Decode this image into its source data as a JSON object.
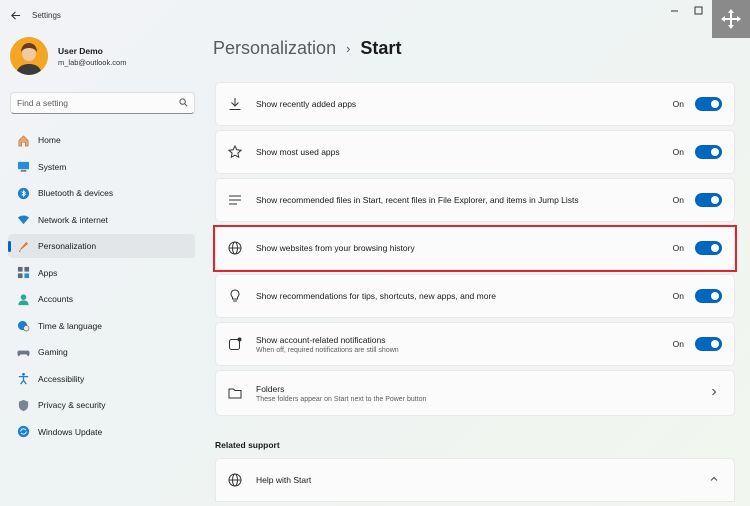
{
  "app": {
    "title": "Settings"
  },
  "user": {
    "name": "User Demo",
    "email": "m_lab@outlook.com"
  },
  "search": {
    "placeholder": "Find a setting"
  },
  "nav": [
    {
      "label": "Home",
      "icon": "home-icon"
    },
    {
      "label": "System",
      "icon": "system-icon"
    },
    {
      "label": "Bluetooth & devices",
      "icon": "bluetooth-icon"
    },
    {
      "label": "Network & internet",
      "icon": "wifi-icon"
    },
    {
      "label": "Personalization",
      "icon": "brush-icon",
      "active": true
    },
    {
      "label": "Apps",
      "icon": "apps-icon"
    },
    {
      "label": "Accounts",
      "icon": "accounts-icon"
    },
    {
      "label": "Time & language",
      "icon": "globe-clock-icon"
    },
    {
      "label": "Gaming",
      "icon": "controller-icon"
    },
    {
      "label": "Accessibility",
      "icon": "accessibility-icon"
    },
    {
      "label": "Privacy & security",
      "icon": "shield-icon"
    },
    {
      "label": "Windows Update",
      "icon": "update-icon"
    }
  ],
  "breadcrumb": {
    "parent": "Personalization",
    "separator": "›",
    "current": "Start"
  },
  "settings": [
    {
      "label": "Show recently added apps",
      "state": "On",
      "icon": "download-icon"
    },
    {
      "label": "Show most used apps",
      "state": "On",
      "icon": "star-icon"
    },
    {
      "label": "Show recommended files in Start, recent files in File Explorer, and items in Jump Lists",
      "state": "On",
      "icon": "list-icon"
    },
    {
      "label": "Show websites from your browsing history",
      "state": "On",
      "icon": "globe-icon"
    },
    {
      "label": "Show recommendations for tips, shortcuts, new apps, and more",
      "state": "On",
      "icon": "lightbulb-icon"
    },
    {
      "label": "Show account-related notifications",
      "description": "When off, required notifications are still shown",
      "state": "On",
      "icon": "notification-icon"
    },
    {
      "label": "Folders",
      "description": "These folders appear on Start next to the Power button",
      "icon": "folder-icon"
    }
  ],
  "related": {
    "title": "Related support",
    "help_label": "Help with Start"
  },
  "colors": {
    "accent": "#0067c0",
    "highlight": "#d9282f"
  }
}
